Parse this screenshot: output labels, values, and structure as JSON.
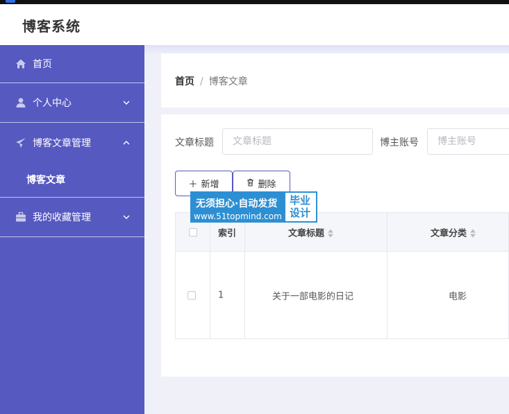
{
  "app": {
    "title": "博客系统"
  },
  "sidebar": {
    "items": [
      {
        "label": "首页",
        "icon": "home-icon"
      },
      {
        "label": "个人中心",
        "icon": "user-icon"
      },
      {
        "label": "博客文章管理",
        "icon": "paper-plane-icon",
        "expanded": true,
        "sub": [
          {
            "label": "博客文章"
          }
        ]
      },
      {
        "label": "我的收藏管理",
        "icon": "briefcase-icon"
      }
    ]
  },
  "breadcrumb": {
    "home": "首页",
    "separator": "/",
    "current": "博客文章"
  },
  "search": {
    "title_label": "文章标题",
    "title_placeholder": "文章标题",
    "account_label": "博主账号",
    "account_placeholder": "博主账号"
  },
  "toolbar": {
    "add_label": "新增",
    "delete_label": "删除"
  },
  "table": {
    "headers": [
      "索引",
      "文章标题",
      "文章分类"
    ],
    "rows": [
      {
        "index": "1",
        "title": "关于一部电影的日记",
        "category": "电影"
      }
    ]
  },
  "watermark": {
    "line1": "无须担心·自动发货",
    "line2": "www.51topmind.com",
    "right1": "毕业",
    "right2": "设计"
  },
  "colors": {
    "sidebar": "#5659c0",
    "accent": "#5659c0",
    "background": "#f0f1f8"
  }
}
